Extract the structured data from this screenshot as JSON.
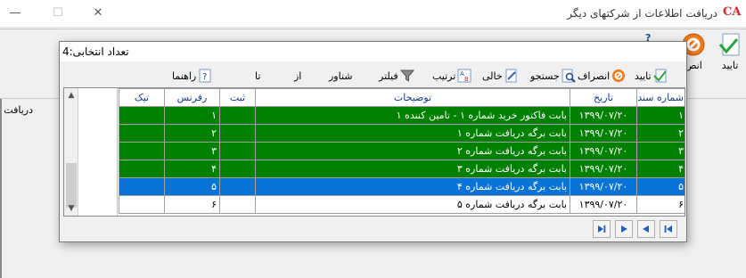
{
  "window": {
    "title": "دریافت اطلاعات از شرکتهای دیگر",
    "logo": "CA"
  },
  "main_toolbar": {
    "approve_label": "تایید",
    "cancel_label": "انص"
  },
  "main_content": {
    "label": "دریافت اسناد"
  },
  "dialog": {
    "title": "تعداد انتخابی:4",
    "toolbar": {
      "approve": "تایید",
      "cancel": "انصراف",
      "search": "جستجو",
      "empty": "خالی",
      "sort": "ترتیب",
      "filter": "فیلتر",
      "float": "شناور",
      "from": "از",
      "to": "تا",
      "help": "راهنما"
    },
    "columns": [
      "شماره سند",
      "تاریخ",
      "توضیحات",
      "ثبت",
      "رفرنس",
      "تیک"
    ],
    "rows": [
      {
        "code": "۱",
        "date": "۱۳۹۹/۰۷/۲۰",
        "desc": "بابت فاکتور خرید شماره ۱ - تامین کننده ۱",
        "reg": "",
        "ref": "۱",
        "tick": ""
      },
      {
        "code": "۲",
        "date": "۱۳۹۹/۰۷/۲۰",
        "desc": "بابت برگه دریافت شماره ۱",
        "reg": "",
        "ref": "۲",
        "tick": ""
      },
      {
        "code": "۳",
        "date": "۱۳۹۹/۰۷/۲۰",
        "desc": "بابت برگه دریافت شماره ۲",
        "reg": "",
        "ref": "۳",
        "tick": ""
      },
      {
        "code": "۴",
        "date": "۱۳۹۹/۰۷/۲۰",
        "desc": "بابت برگه دریافت شماره ۳",
        "reg": "",
        "ref": "۴",
        "tick": ""
      },
      {
        "code": "۵",
        "date": "۱۳۹۹/۰۷/۲۰",
        "desc": "بابت برگه دریافت شماره ۴",
        "reg": "",
        "ref": "۵",
        "tick": ""
      },
      {
        "code": "۶",
        "date": "۱۳۹۹/۰۷/۲۰",
        "desc": "بابت برگه دریافت شماره ۵",
        "reg": "",
        "ref": "۶",
        "tick": ""
      }
    ],
    "row_states": [
      "green",
      "green",
      "green",
      "green",
      "selected",
      "plain"
    ]
  },
  "colors": {
    "green_row": "#008000",
    "selected_row": "#0a73d6",
    "header_text": "#1a3a8c"
  },
  "icons": [
    "check-icon",
    "cancel-icon",
    "search-icon",
    "clear-icon",
    "sort-icon",
    "filter-icon",
    "help-icon",
    "first-icon",
    "next-icon",
    "prev-icon",
    "last-icon"
  ]
}
